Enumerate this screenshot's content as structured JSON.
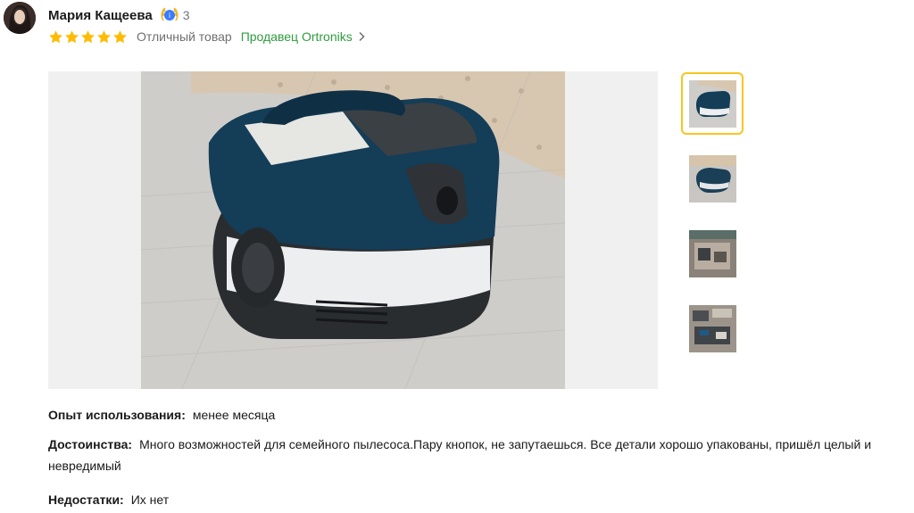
{
  "review": {
    "author_name": "Мария Кащеева",
    "badge_icon": "laurel-badge-icon",
    "badge_count": "3",
    "rating": 5,
    "rating_max": 5,
    "rating_text": "Отличный товар",
    "seller_link": "Продавец Ortroniks",
    "fields": [
      {
        "label": "Опыт использования:",
        "value": "менее месяца"
      },
      {
        "label": "Достоинства:",
        "value": "Много возможностей для семейного пылесоса.Пару кнопок, не запутаешься. Все детали хорошо упакованы, пришёл целый и невредимый"
      },
      {
        "label": "Недостатки:",
        "value": "Их нет"
      }
    ]
  },
  "colors": {
    "star": "#ffbb00",
    "seller_link": "#2e9c3e",
    "thumb_active_border": "#f7c520",
    "badge_blue": "#3a7bff"
  }
}
